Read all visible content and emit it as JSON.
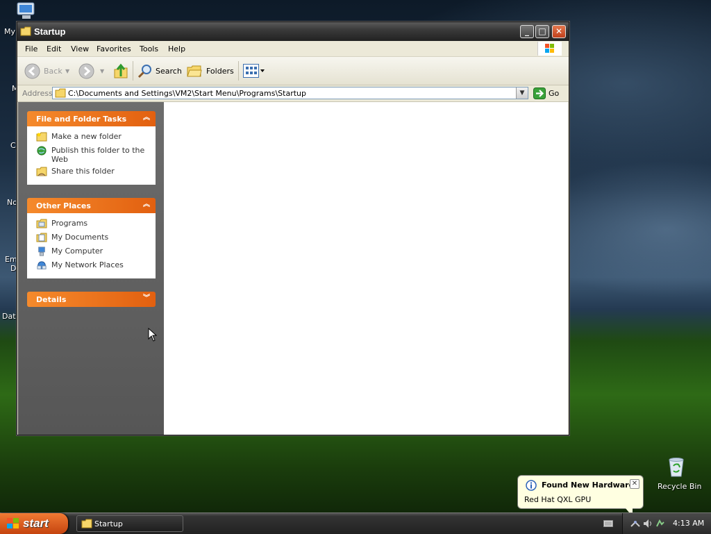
{
  "desktop": {
    "labels": [
      "My",
      "M",
      "C",
      "No",
      "Em",
      "D",
      "Dat"
    ],
    "recycle_bin": "Recycle Bin"
  },
  "window": {
    "title": "Startup",
    "buttons": {
      "minimize": "_",
      "maximize": "□",
      "close": "✕"
    }
  },
  "menubar": {
    "items": [
      "File",
      "Edit",
      "View",
      "Favorites",
      "Tools",
      "Help"
    ]
  },
  "toolbar": {
    "back": "Back",
    "search": "Search",
    "folders": "Folders"
  },
  "address": {
    "label": "Address",
    "value": "C:\\Documents and Settings\\VM2\\Start Menu\\Programs\\Startup",
    "go": "Go"
  },
  "taskpane": {
    "file_tasks": {
      "title": "File and Folder Tasks",
      "items": [
        "Make a new folder",
        "Publish this folder to the Web",
        "Share this folder"
      ]
    },
    "other_places": {
      "title": "Other Places",
      "items": [
        "Programs",
        "My Documents",
        "My Computer",
        "My Network Places"
      ]
    },
    "details": {
      "title": "Details"
    }
  },
  "taskbar": {
    "start": "start",
    "window_button": "Startup",
    "clock": "4:13 AM"
  },
  "balloon": {
    "title": "Found New Hardware",
    "message": "Red Hat QXL GPU"
  },
  "colors": {
    "panel_header": "#e26010",
    "start_button": "#c5440f",
    "balloon_bg": "#ffffe1"
  }
}
